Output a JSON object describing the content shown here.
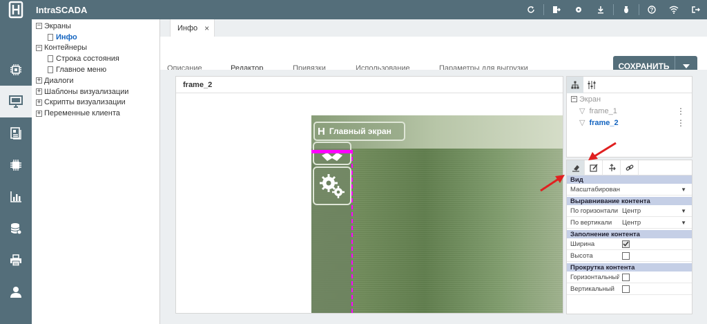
{
  "app": {
    "title": "IntraSCADA"
  },
  "top_icons": [
    "refresh-icon",
    "exit-icon",
    "settings-icon",
    "download-icon",
    "bug-icon",
    "help-icon",
    "wifi-icon",
    "logout-icon"
  ],
  "rail": [
    "processor-icon",
    "monitor-icon",
    "document-icon",
    "chip-icon",
    "bar-chart-icon",
    "database-icon",
    "printer-icon",
    "user-icon"
  ],
  "tree": {
    "items": [
      {
        "label": "Экраны",
        "toggle": "−",
        "level": 0
      },
      {
        "label": "Инфо",
        "level": 1,
        "selected": true
      },
      {
        "label": "Контейнеры",
        "toggle": "−",
        "level": 0
      },
      {
        "label": "Строка состояния",
        "level": 1
      },
      {
        "label": "Главное меню",
        "level": 1
      },
      {
        "label": "Диалоги",
        "toggle": "+",
        "level": 0
      },
      {
        "label": "Шаблоны визуализации",
        "toggle": "+",
        "level": 0
      },
      {
        "label": "Скрипты визуализации",
        "toggle": "+",
        "level": 0
      },
      {
        "label": "Переменные клиента",
        "toggle": "+",
        "level": 0
      }
    ]
  },
  "doc_tab": {
    "label": "Инфо",
    "close": "×"
  },
  "subtabs": [
    "Описание",
    "Редактор",
    "Привязки",
    "Использование",
    "Параметры для выгрузки"
  ],
  "save_button": {
    "label": "СОХРАНИТЬ"
  },
  "canvas": {
    "title": "frame_2",
    "screen_title": "Главный экран",
    "screen_logo": "H"
  },
  "objects": {
    "root": "Экран",
    "items": [
      {
        "label": "frame_1",
        "selected": false
      },
      {
        "label": "frame_2",
        "selected": true
      }
    ]
  },
  "props": {
    "view_section": "Вид",
    "scale_value": "Масштабирован",
    "align_section": "Выравнивание контента",
    "h_label": "По горизонтали",
    "h_value": "Центр",
    "v_label": "По вертикали",
    "v_value": "Центр",
    "fill_section": "Заполнение контента",
    "width_label": "Ширина",
    "width_checked": true,
    "height_label": "Высота",
    "height_checked": false,
    "scroll_section": "Прокрутка контента",
    "hscroll_label": "Горизонтальный",
    "hscroll_checked": false,
    "vscroll_label": "Вертикальный",
    "vscroll_checked": false
  },
  "colors": {
    "accent": "#546e7a",
    "selection": "#ff00ff",
    "link": "#1565c0",
    "section": "#c5cfe6",
    "arrow": "#e02020"
  }
}
